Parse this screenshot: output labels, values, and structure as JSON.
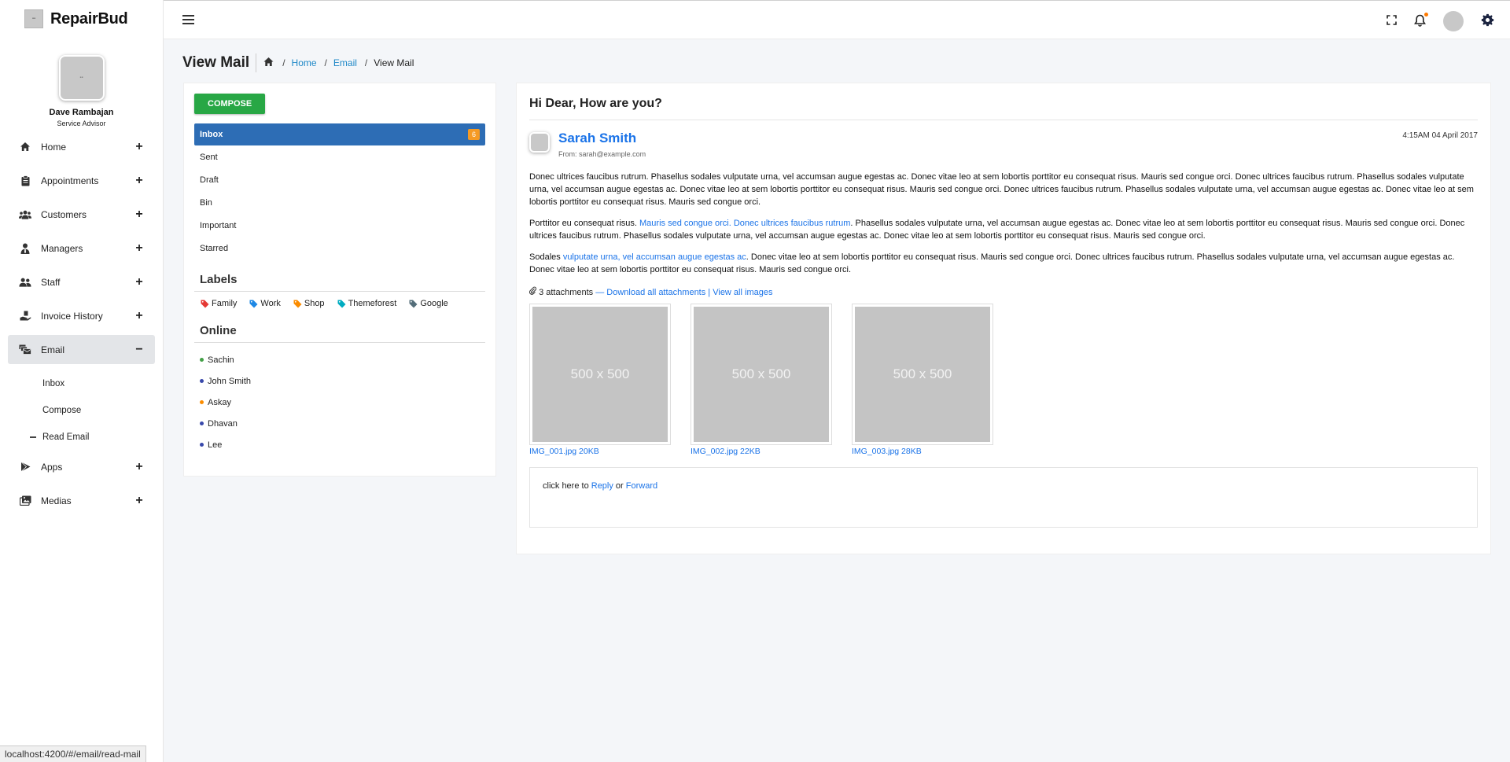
{
  "app": {
    "name": "RepairBud"
  },
  "profile": {
    "name": "Dave Rambajan",
    "role": "Service Advisor"
  },
  "sidebar": {
    "items": [
      {
        "label": "Home",
        "icon": "home-icon",
        "toggle": "+"
      },
      {
        "label": "Appointments",
        "icon": "clipboard-icon",
        "toggle": "+"
      },
      {
        "label": "Customers",
        "icon": "users-icon",
        "toggle": "+"
      },
      {
        "label": "Managers",
        "icon": "user-tie-icon",
        "toggle": "+"
      },
      {
        "label": "Staff",
        "icon": "user-friends-icon",
        "toggle": "+"
      },
      {
        "label": "Invoice History",
        "icon": "hand-holding-icon",
        "toggle": "+"
      },
      {
        "label": "Email",
        "icon": "mail-bulk-icon",
        "toggle": "−"
      },
      {
        "label": "Apps",
        "icon": "play-icon",
        "toggle": "+"
      },
      {
        "label": "Medias",
        "icon": "images-icon",
        "toggle": "+"
      }
    ],
    "email_sub": [
      "Inbox",
      "Compose",
      "Read Email"
    ]
  },
  "header": {
    "title": "View Mail",
    "breadcrumb": [
      "Home",
      "Email",
      "View Mail"
    ]
  },
  "mailnav": {
    "compose": "COMPOSE",
    "folders": [
      {
        "label": "Inbox",
        "count": "6"
      },
      {
        "label": "Sent"
      },
      {
        "label": "Draft"
      },
      {
        "label": "Bin"
      },
      {
        "label": "Important"
      },
      {
        "label": "Starred"
      }
    ],
    "labels_title": "Labels",
    "labels": [
      {
        "name": "Family",
        "color": "#e53935"
      },
      {
        "name": "Work",
        "color": "#1e88e5"
      },
      {
        "name": "Shop",
        "color": "#fb8c00"
      },
      {
        "name": "Themeforest",
        "color": "#00acc1"
      },
      {
        "name": "Google",
        "color": "#546e7a"
      }
    ],
    "online_title": "Online",
    "online": [
      {
        "name": "Sachin",
        "color": "#43a047"
      },
      {
        "name": "John Smith",
        "color": "#3949ab"
      },
      {
        "name": "Askay",
        "color": "#fb8c00"
      },
      {
        "name": "Dhavan",
        "color": "#3949ab"
      },
      {
        "name": "Lee",
        "color": "#3949ab"
      }
    ]
  },
  "mail": {
    "subject": "Hi Dear, How are you?",
    "sender": "Sarah Smith",
    "from": "From: sarah@example.com",
    "date": "4:15AM 04 April 2017",
    "p1": "Donec ultrices faucibus rutrum. Phasellus sodales vulputate urna, vel accumsan augue egestas ac. Donec vitae leo at sem lobortis porttitor eu consequat risus. Mauris sed congue orci. Donec ultrices faucibus rutrum. Phasellus sodales vulputate urna, vel accumsan augue egestas ac. Donec vitae leo at sem lobortis porttitor eu consequat risus. Mauris sed congue orci. Donec ultrices faucibus rutrum. Phasellus sodales vulputate urna, vel accumsan augue egestas ac. Donec vitae leo at sem lobortis porttitor eu consequat risus. Mauris sed congue orci.",
    "p2_start": "Porttitor eu consequat risus. ",
    "p2_link": "Mauris sed congue orci. Donec ultrices faucibus rutrum",
    "p2_end": ". Phasellus sodales vulputate urna, vel accumsan augue egestas ac. Donec vitae leo at sem lobortis porttitor eu consequat risus. Mauris sed congue orci. Donec ultrices faucibus rutrum. Phasellus sodales vulputate urna, vel accumsan augue egestas ac. Donec vitae leo at sem lobortis porttitor eu consequat risus. Mauris sed congue orci.",
    "p3_start": "Sodales ",
    "p3_link": "vulputate urna, vel accumsan augue egestas ac",
    "p3_end": ". Donec vitae leo at sem lobortis porttitor eu consequat risus. Mauris sed congue orci. Donec ultrices faucibus rutrum. Phasellus sodales vulputate urna, vel accumsan augue egestas ac. Donec vitae leo at sem lobortis porttitor eu consequat risus. Mauris sed congue orci.",
    "attach_count": "3 attachments",
    "attach_dash": " — ",
    "download_all": "Download all attachments",
    "attach_sep": " | ",
    "view_images": "View all images",
    "attachments": [
      {
        "placeholder": "500 x 500",
        "caption": "IMG_001.jpg 20KB"
      },
      {
        "placeholder": "500 x 500",
        "caption": "IMG_002.jpg 22KB"
      },
      {
        "placeholder": "500 x 500",
        "caption": "IMG_003.jpg 28KB"
      }
    ],
    "reply_prefix": "click here to ",
    "reply": "Reply",
    "reply_or": " or ",
    "forward": "Forward"
  },
  "status_url": "localhost:4200/#/email/read-mail"
}
